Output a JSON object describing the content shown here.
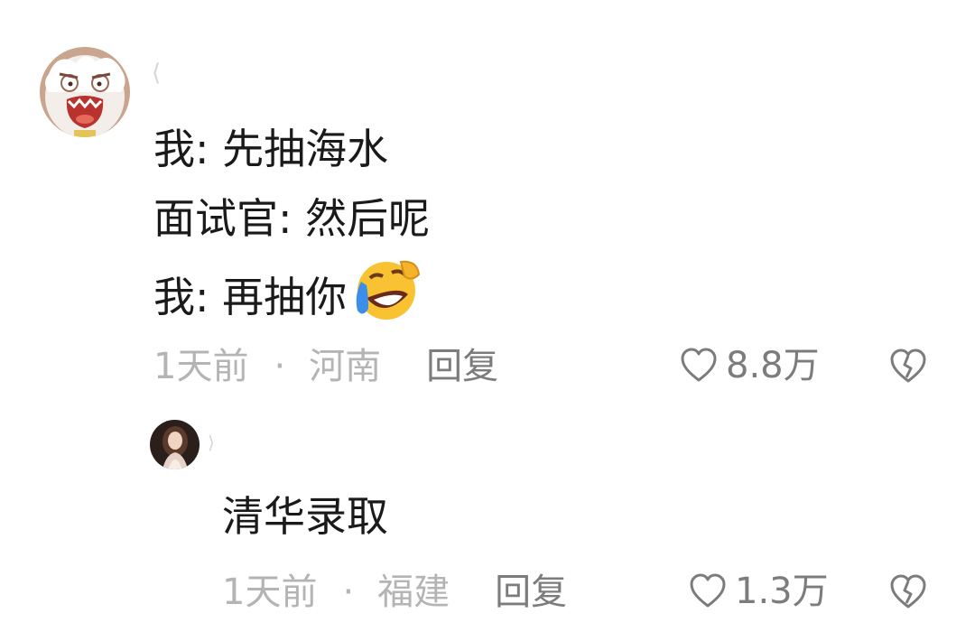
{
  "comments": [
    {
      "avatar_icon": "cartoon-screaming-face-avatar",
      "lines": [
        "我: 先抽海水",
        "面试官: 然后呢",
        "我: 再抽你"
      ],
      "emoji": "rolling-on-floor-laughing-emoji",
      "time": "1天前",
      "separator": "·",
      "location": "河南",
      "reply_label": "回复",
      "likes": "8.8万"
    },
    {
      "avatar_icon": "woman-portrait-avatar",
      "lines": [
        "清华录取"
      ],
      "time": "1天前",
      "separator": "·",
      "location": "福建",
      "reply_label": "回复",
      "likes": "1.3万"
    }
  ],
  "icons": {
    "like": "heart-outline-icon",
    "dislike": "broken-heart-icon"
  },
  "colors": {
    "text_primary": "#1a1a1a",
    "text_secondary": "#b4b4b4",
    "action_gray": "#7c7c7c",
    "background": "#ffffff"
  }
}
